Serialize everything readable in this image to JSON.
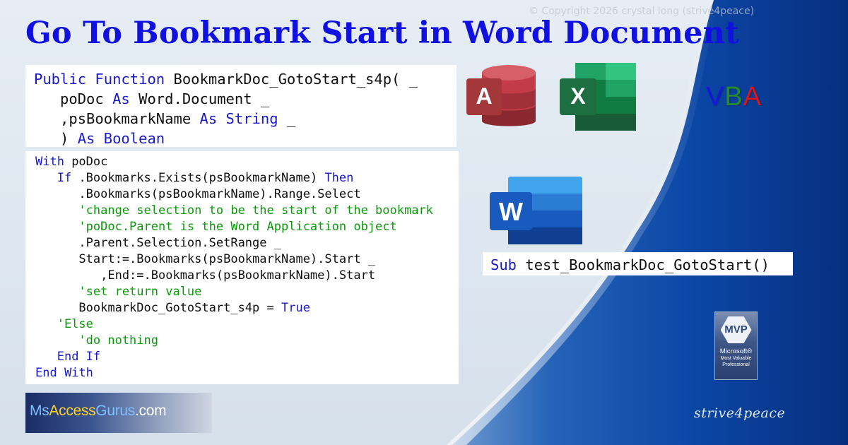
{
  "copyright": "© Copyright 2026 crystal long (strive4peace)",
  "title": "Go To Bookmark Start in Word Document",
  "signature": [
    [
      {
        "t": "Public Function ",
        "c": "kw"
      },
      {
        "t": "BookmarkDoc_GotoStart_s4p( _",
        "c": ""
      }
    ],
    [
      {
        "t": "   poDoc ",
        "c": ""
      },
      {
        "t": "As",
        "c": "kw"
      },
      {
        "t": " Word.Document _",
        "c": ""
      }
    ],
    [
      {
        "t": "   ,psBookmarkName ",
        "c": ""
      },
      {
        "t": "As String",
        "c": "kw"
      },
      {
        "t": " _",
        "c": ""
      }
    ],
    [
      {
        "t": "   ) ",
        "c": ""
      },
      {
        "t": "As Boolean",
        "c": "kw"
      }
    ]
  ],
  "code": [
    [
      {
        "t": "With",
        "c": "kw"
      },
      {
        "t": " poDoc",
        "c": ""
      }
    ],
    [
      {
        "t": "   ",
        "c": ""
      },
      {
        "t": "If",
        "c": "kw"
      },
      {
        "t": " .Bookmarks.Exists(psBookmarkName) ",
        "c": ""
      },
      {
        "t": "Then",
        "c": "kw"
      }
    ],
    [
      {
        "t": "      .Bookmarks(psBookmarkName).Range.Select",
        "c": ""
      }
    ],
    [
      {
        "t": "      'change selection to be the start of the bookmark",
        "c": "cm"
      }
    ],
    [
      {
        "t": "      'poDoc.Parent is the Word Application object",
        "c": "cm"
      }
    ],
    [
      {
        "t": "      .Parent.Selection.SetRange _",
        "c": ""
      }
    ],
    [
      {
        "t": "      Start:=.Bookmarks(psBookmarkName).Start _",
        "c": ""
      }
    ],
    [
      {
        "t": "         ,End:=.Bookmarks(psBookmarkName).Start",
        "c": ""
      }
    ],
    [
      {
        "t": "      'set return value",
        "c": "cm"
      }
    ],
    [
      {
        "t": "      BookmarkDoc_GotoStart_s4p = ",
        "c": ""
      },
      {
        "t": "True",
        "c": "kw"
      }
    ],
    [
      {
        "t": "   'Else",
        "c": "cm"
      }
    ],
    [
      {
        "t": "      'do nothing",
        "c": "cm"
      }
    ],
    [
      {
        "t": "   ",
        "c": ""
      },
      {
        "t": "End If",
        "c": "kw"
      }
    ],
    [
      {
        "t": "End With",
        "c": "kw"
      }
    ]
  ],
  "test_sub": {
    "keyword": "Sub",
    "name": " test_BookmarkDoc_GotoStart()"
  },
  "icons": {
    "access": {
      "name": "access-icon",
      "letter": "A",
      "color": "#a4373a"
    },
    "excel": {
      "name": "excel-icon",
      "letter": "X",
      "color": "#1d6f42"
    },
    "word": {
      "name": "word-icon",
      "letter": "W",
      "color": "#185abd"
    }
  },
  "vba": {
    "v": "V",
    "b": "B",
    "a": "A",
    "v_color": "#1515dd",
    "b_color": "#2a8a2a",
    "a_color": "#dd1515"
  },
  "logo": {
    "part1": "Ms",
    "part2": "Access",
    "part3": "Gurus",
    "part4": ".com"
  },
  "mvp": {
    "badge": "MVP",
    "line1": "Microsoft®",
    "line2": "Most Valuable",
    "line3": "Professional"
  },
  "signature_text": "strive4peace"
}
